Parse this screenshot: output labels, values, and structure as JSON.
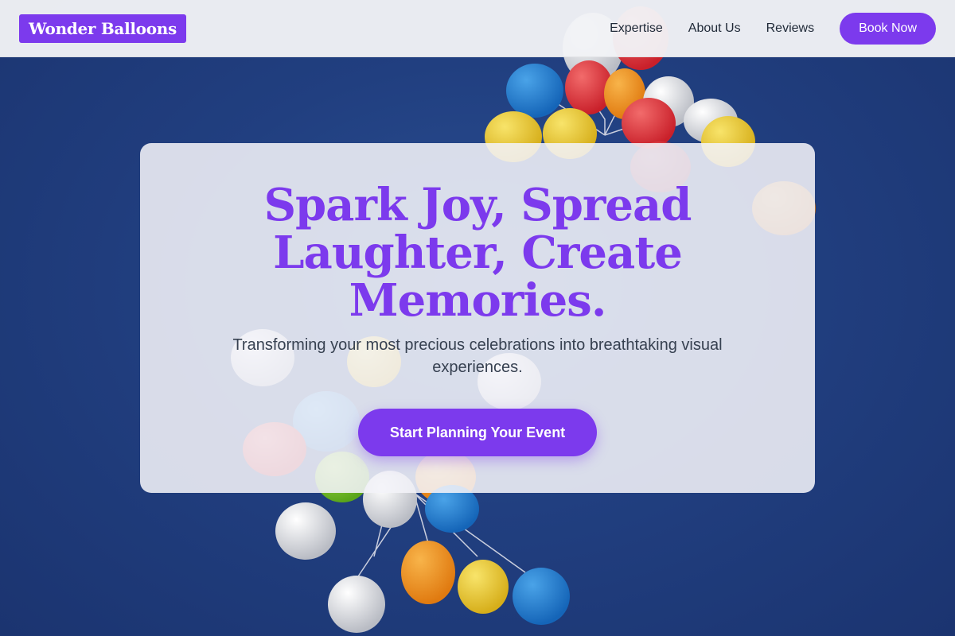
{
  "header": {
    "logo_text": "Wonder Balloons",
    "nav": [
      {
        "label": "Expertise"
      },
      {
        "label": "About Us"
      },
      {
        "label": "Reviews"
      }
    ],
    "book_button": "Book Now"
  },
  "hero": {
    "title": "Spark Joy, Spread Laughter, Create Memories.",
    "subtitle": "Transforming your most precious celebrations into breathtaking visual experiences.",
    "cta": "Start Planning Your Event"
  },
  "colors": {
    "accent": "#7c3aed",
    "sky": "#213f80"
  }
}
